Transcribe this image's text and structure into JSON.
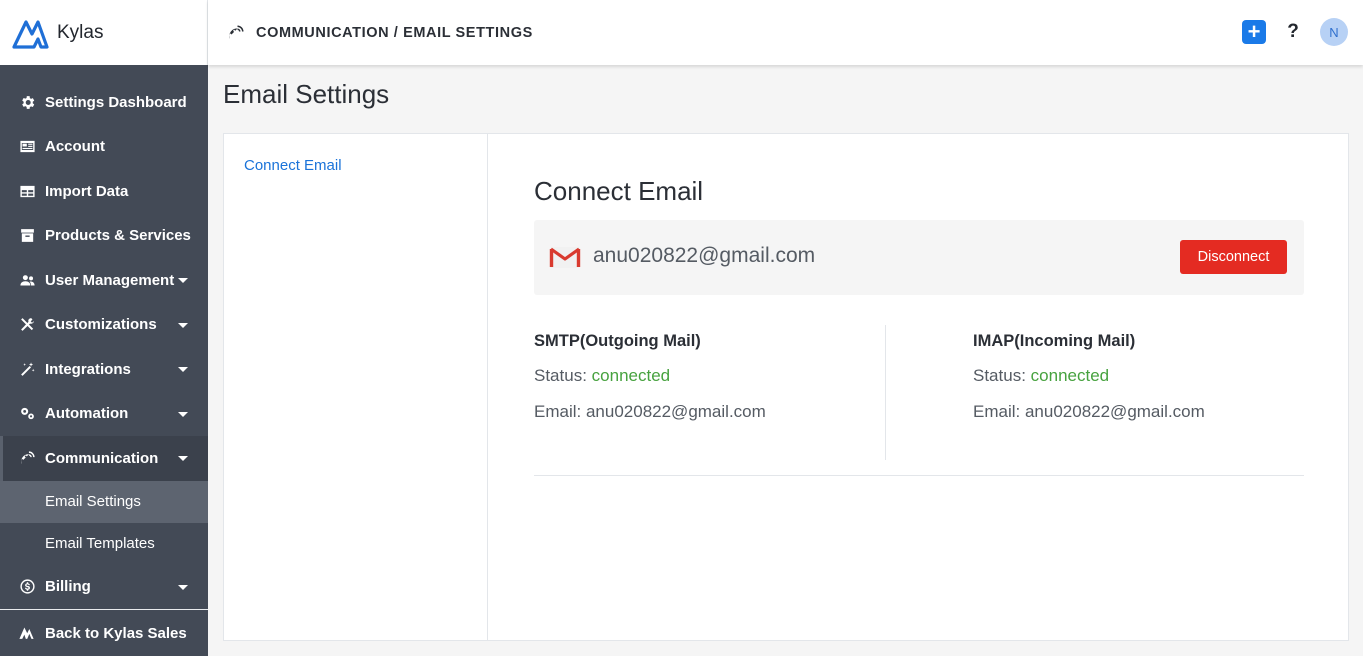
{
  "app": {
    "name": "Kylas"
  },
  "header": {
    "breadcrumb": "COMMUNICATION / EMAIL SETTINGS",
    "help_label": "?",
    "avatar_initial": "N",
    "add_label": "+"
  },
  "sidebar": {
    "items": [
      {
        "label": "Settings Dashboard",
        "icon": "gear-icon"
      },
      {
        "label": "Account",
        "icon": "account-card-icon"
      },
      {
        "label": "Import Data",
        "icon": "table-icon"
      },
      {
        "label": "Products & Services",
        "icon": "box-icon"
      },
      {
        "label": "User Management",
        "icon": "users-icon"
      },
      {
        "label": "Customizations",
        "icon": "tools-icon"
      },
      {
        "label": "Integrations",
        "icon": "magic-wand-icon"
      },
      {
        "label": "Automation",
        "icon": "cogs-icon"
      },
      {
        "label": "Communication",
        "icon": "satellite-dish-icon"
      }
    ],
    "communication_sub": [
      {
        "label": "Email Settings"
      },
      {
        "label": "Email Templates"
      }
    ],
    "billing": {
      "label": "Billing",
      "icon": "dollar-circle-icon"
    },
    "back_label": "Back to Kylas Sales"
  },
  "page": {
    "title": "Email Settings",
    "left_nav_link": "Connect Email",
    "section_title": "Connect Email",
    "connected_email": "anu020822@gmail.com",
    "disconnect_label": "Disconnect",
    "smtp": {
      "title": "SMTP(Outgoing Mail)",
      "status_label": "Status:",
      "status_value": "connected",
      "email_label": "Email:",
      "email_value": "anu020822@gmail.com"
    },
    "imap": {
      "title": "IMAP(Incoming Mail)",
      "status_label": "Status:",
      "status_value": "connected",
      "email_label": "Email:",
      "email_value": "anu020822@gmail.com"
    }
  },
  "colors": {
    "sidebar_bg": "#434a56",
    "active_sub_bg": "#5d6470",
    "accent_blue": "#1a7ae8",
    "link_blue": "#1a73d9",
    "danger_red": "#e42b22",
    "status_green": "#47a23f"
  }
}
